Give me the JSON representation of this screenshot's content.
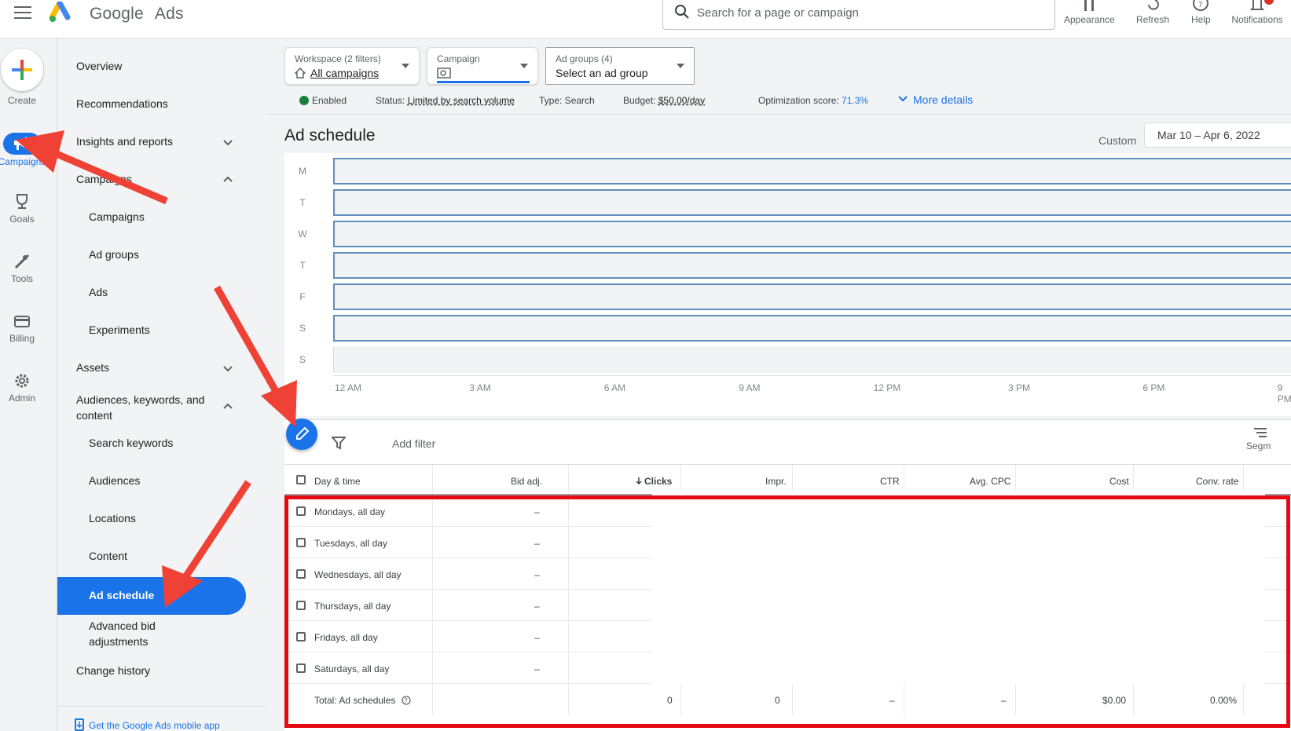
{
  "app": {
    "brand_google": "Google",
    "brand_ads": "Ads"
  },
  "topbar": {
    "search_placeholder": "Search for a page or campaign",
    "appearance": "Appearance",
    "refresh": "Refresh",
    "help": "Help",
    "notifications": "Notifications"
  },
  "rail": {
    "create": "Create",
    "campaigns": "Campaigns",
    "goals": "Goals",
    "tools": "Tools",
    "billing": "Billing",
    "admin": "Admin"
  },
  "nav": {
    "overview": "Overview",
    "recommendations": "Recommendations",
    "insights": "Insights and reports",
    "campaigns_group": "Campaigns",
    "campaigns": "Campaigns",
    "ad_groups": "Ad groups",
    "ads": "Ads",
    "experiments": "Experiments",
    "assets": "Assets",
    "audiences_line1": "Audiences, keywords, and",
    "audiences_line2": "content",
    "search_keywords": "Search keywords",
    "audiences": "Audiences",
    "locations": "Locations",
    "content": "Content",
    "ad_schedule": "Ad schedule",
    "advanced_line1": "Advanced bid",
    "advanced_line2": "adjustments",
    "change_history": "Change history",
    "mobile_app": "Get the Google Ads mobile app"
  },
  "filters": {
    "workspace_label": "Workspace (2 filters)",
    "workspace_value": "All campaigns",
    "campaign_label": "Campaign",
    "adgroups_label": "Ad groups (4)",
    "adgroups_value": "Select an ad group"
  },
  "status": {
    "enabled": "Enabled",
    "status_label": "Status:",
    "status_value": "Limited by search volume",
    "type": "Type: Search",
    "budget_label": "Budget:",
    "budget_value": "$50.00/day",
    "opt_label": "Optimization score:",
    "opt_value": "71.3%",
    "more_details": "More details"
  },
  "page": {
    "title": "Ad schedule",
    "custom": "Custom",
    "date_range": "Mar 10 – Apr 6, 2022"
  },
  "schedule": {
    "days": [
      "M",
      "T",
      "W",
      "T",
      "F",
      "S",
      "S"
    ],
    "scheduled": [
      true,
      true,
      true,
      true,
      true,
      true,
      false
    ],
    "ticks": [
      "12 AM",
      "3 AM",
      "6 AM",
      "9 AM",
      "12 PM",
      "3 PM",
      "6 PM",
      "9 PM"
    ]
  },
  "table": {
    "add_filter": "Add filter",
    "segment": "Segm",
    "headers": {
      "day_time": "Day & time",
      "bid_adj": "Bid adj.",
      "clicks": "Clicks",
      "impr": "Impr.",
      "ctr": "CTR",
      "avg_cpc": "Avg. CPC",
      "cost": "Cost",
      "conv_rate": "Conv. rate"
    },
    "rows": [
      {
        "day": "Mondays, all day",
        "bid": "–"
      },
      {
        "day": "Tuesdays, all day",
        "bid": "–"
      },
      {
        "day": "Wednesdays, all day",
        "bid": "–"
      },
      {
        "day": "Thursdays, all day",
        "bid": "–"
      },
      {
        "day": "Fridays, all day",
        "bid": "–"
      },
      {
        "day": "Saturdays, all day",
        "bid": "–"
      }
    ],
    "total": {
      "label": "Total: Ad schedules",
      "clicks": "0",
      "impr": "0",
      "ctr": "–",
      "avg_cpc": "–",
      "cost": "$0.00",
      "conv_rate": "0.00%"
    }
  },
  "colors": {
    "primary": "#1a73e8",
    "annotation_red": "#e50914",
    "enabled_green": "#188038"
  }
}
